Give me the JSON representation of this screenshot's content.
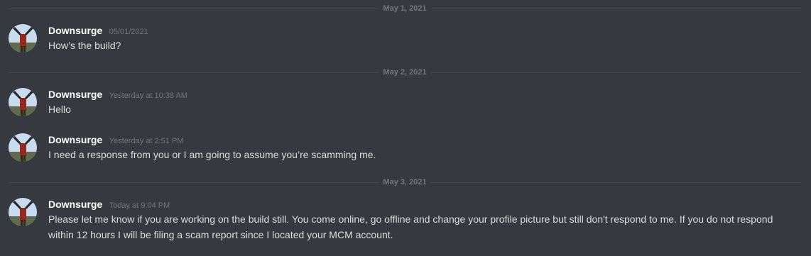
{
  "dividers": [
    {
      "date": "May 1, 2021"
    },
    {
      "date": "May 2, 2021"
    },
    {
      "date": "May 3, 2021"
    }
  ],
  "messages": [
    {
      "author": "Downsurge",
      "timestamp": "05/01/2021",
      "text": "How’s the build?",
      "avatar_icon": "red-figure-sky-avatar"
    },
    {
      "author": "Downsurge",
      "timestamp": "Yesterday at 10:38 AM",
      "text": "Hello",
      "avatar_icon": "red-figure-sky-avatar"
    },
    {
      "author": "Downsurge",
      "timestamp": "Yesterday at 2:51 PM",
      "text": "I need a response from you or I am going to assume you’re scamming me.",
      "avatar_icon": "red-figure-sky-avatar"
    },
    {
      "author": "Downsurge",
      "timestamp": "Today at 9:04 PM",
      "text": "Please let me know if you are working on the build still. You come online, go offline and change your profile picture but still don't respond to me. If you do not respond within 12 hours I will be filing a scam report since I located your MCM account.",
      "avatar_icon": "red-figure-sky-avatar"
    }
  ],
  "colors": {
    "background": "#36393f",
    "username": "#ffffff",
    "message_text": "#dcddde",
    "muted": "#72767d",
    "divider": "#42454a"
  }
}
